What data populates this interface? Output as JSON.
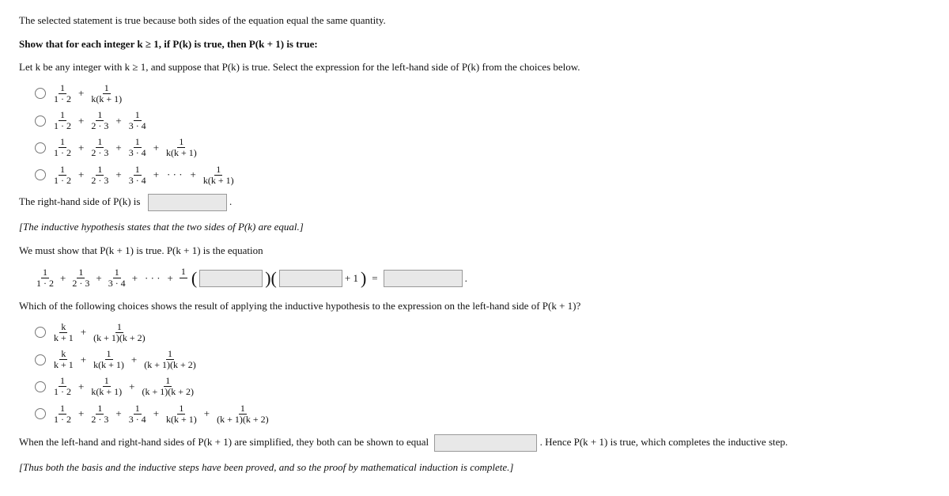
{
  "page": {
    "intro_statement": "The selected statement is true because both sides of the equation equal the same quantity.",
    "show_that_label": "Show that for each integer k ≥ 1, if P(k) is true, then P(k + 1) is true:",
    "let_k_text": "Let k be any integer with k ≥ 1, and suppose that P(k) is true. Select the expression for the left-hand side of P(k) from the choices below.",
    "rhs_label": "The right-hand side of P(k) is",
    "inductive_hypothesis": "[The inductive hypothesis states that the two sides of P(k) are equal.]",
    "we_must_show": "We must show that P(k + 1) is true. P(k + 1) is the equation",
    "which_choice": "Which of the following choices shows the result of applying the inductive hypothesis to the expression on the left-hand side of P(k + 1)?",
    "when_simplified": "When the left-hand and right-hand sides of P(k + 1) are simplified, they both can be shown to equal",
    "hence_text": ". Hence P(k + 1) is true, which completes the inductive step.",
    "thus_text": "[Thus both the basis and the inductive steps have been proved, and so the proof by mathematical induction is complete.]",
    "radio_options_lhs": [
      {
        "id": "opt1",
        "label": "1/(1·2) + 1/(k(k+1))"
      },
      {
        "id": "opt2",
        "label": "1/(1·2) + 1/(2·3) + 1/(3·4)"
      },
      {
        "id": "opt3",
        "label": "1/(1·2) + 1/(2·3) + 1/(3·4) + 1/(k(k+1))"
      },
      {
        "id": "opt4",
        "label": "1/(1·2) + 1/(2·3) + 1/(3·4) + ... + 1/(k(k+1))"
      }
    ],
    "radio_options_apply": [
      {
        "id": "appl1",
        "label": "k/(k+1) + 1/((k+1)(k+2))"
      },
      {
        "id": "appl2",
        "label": "k/(k+1) + 1/(k(k+1)) + 1/((k+1)(k+2))"
      },
      {
        "id": "appl3",
        "label": "1/(1·2) + 1/(k(k+1)) + 1/((k+1)(k+2))"
      },
      {
        "id": "appl4",
        "label": "1/(1·2) + 1/(2·3) + 1/(3·4) + 1/(k(k+1)) + 1/((k+1)(k+2))"
      }
    ]
  }
}
